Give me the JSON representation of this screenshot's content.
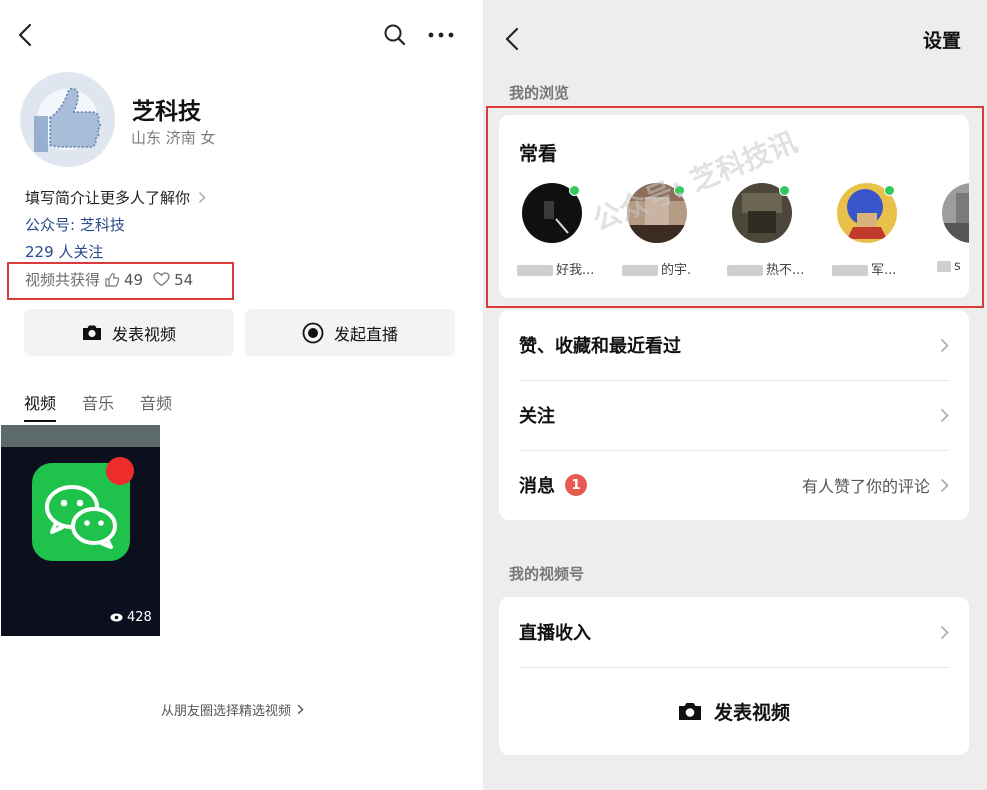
{
  "left": {
    "profile": {
      "name": "芝科技",
      "location": "山东 济南 女",
      "intro_link": "填写简介让更多人了解你",
      "public_account": "公众号: 芝科技",
      "follow_count": "229 人关注"
    },
    "stats": {
      "label": "视频共获得",
      "likes": "49",
      "hearts": "54"
    },
    "actions": {
      "post_video": "发表视频",
      "start_live": "发起直播"
    },
    "tabs": [
      {
        "label": "视频",
        "active": true
      },
      {
        "label": "音乐",
        "active": false
      },
      {
        "label": "音频",
        "active": false
      }
    ],
    "video": {
      "views": "428"
    },
    "select_link": "从朋友圈选择精选视频"
  },
  "right": {
    "title": "设置",
    "section_browse": "我的浏览",
    "frequent": {
      "title": "常看",
      "contacts": [
        {
          "name": "好我...",
          "avatar_color": "#101010",
          "online": true
        },
        {
          "name": "的宇.",
          "avatar_color": "#b59a84",
          "online": true
        },
        {
          "name": "热不...",
          "avatar_color": "#4d473a",
          "online": true
        },
        {
          "name": "军...",
          "avatar_color": "#3855c9",
          "online": true
        },
        {
          "name": "s",
          "avatar_color": "#9d9d9d",
          "online": false
        }
      ]
    },
    "watermark": "公众号: 芝科技讯",
    "list": {
      "likes_favorites": "赞、收藏和最近看过",
      "following": "关注",
      "messages": "消息",
      "messages_badge": "1",
      "messages_hint": "有人赞了你的评论"
    },
    "section_channel": "我的视频号",
    "channel": {
      "live_income": "直播收入",
      "post_video": "发表视频"
    }
  },
  "colors": {
    "highlight_red": "#d93a3a",
    "link_blue": "#2a4a8c",
    "online_green": "#34c75a",
    "wechat_green": "#1fc34b",
    "badge_red": "#e65b51"
  }
}
